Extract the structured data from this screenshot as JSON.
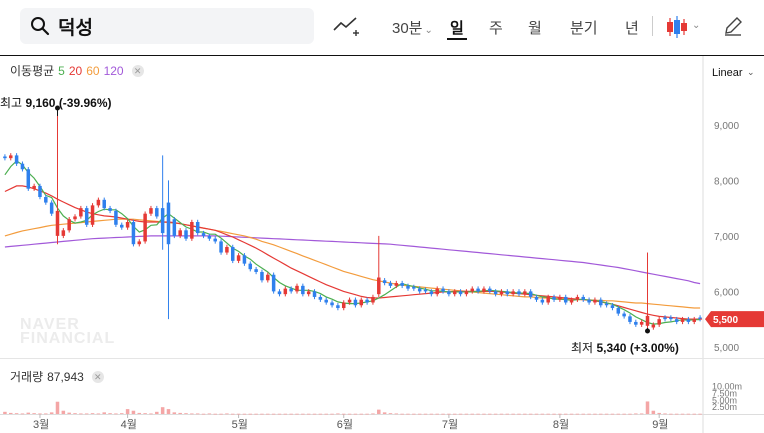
{
  "toolbar": {
    "search_value": "덕성",
    "intervals": [
      "30분",
      "일",
      "주",
      "월",
      "분기",
      "년"
    ],
    "active_interval": "일"
  },
  "ma_legend": {
    "label": "이동평균",
    "periods": [
      {
        "label": "5",
        "color": "#4caf50"
      },
      {
        "label": "20",
        "color": "#e53935"
      },
      {
        "label": "60",
        "color": "#f39c3d"
      },
      {
        "label": "120",
        "color": "#a259d9"
      }
    ]
  },
  "scale_label": "Linear",
  "max_marker": {
    "label": "최고",
    "value": "9,160",
    "change": "(-39.96%)"
  },
  "min_marker": {
    "label": "최저",
    "value": "5,340",
    "change": "(+3.00%)"
  },
  "volume_label": {
    "label": "거래량",
    "value": "87,943"
  },
  "current_price": "5,500",
  "watermark": [
    "NAVER",
    "FINANCIAL"
  ],
  "colors": {
    "up": "#e53935",
    "down": "#2f80ed",
    "ma5": "#4caf50",
    "ma20": "#e53935",
    "ma60": "#f39c3d",
    "ma120": "#a259d9",
    "volume": "#f4a6a6",
    "price_tag": "#e53935"
  },
  "chart_data": {
    "type": "candlestick",
    "y_ticks": [
      "9,000",
      "8,000",
      "7,000",
      "6,000",
      "5,000"
    ],
    "y_ticks_values": [
      9000,
      8000,
      7000,
      6000,
      5000
    ],
    "ylim": [
      4800,
      9700
    ],
    "x_ticks": [
      "3월",
      "4월",
      "5월",
      "6월",
      "7월",
      "8월",
      "9월"
    ],
    "volume_ticks": [
      "10.00m",
      "7.50m",
      "5.00m",
      "2.50m"
    ],
    "volume_ticks_values": [
      10,
      7.5,
      5,
      2.5
    ],
    "volume_max": 11,
    "max_price": 9160,
    "min_price": 5340,
    "last_price": 5500,
    "series_close": [
      8400,
      8450,
      8300,
      8200,
      7850,
      7900,
      7700,
      7600,
      7400,
      7000,
      7100,
      7300,
      7350,
      7500,
      7200,
      7550,
      7650,
      7500,
      7450,
      7200,
      7150,
      7250,
      6850,
      6900,
      7400,
      7500,
      7350,
      7450,
      7300,
      7000,
      7100,
      6950,
      7250,
      7050,
      7000,
      6950,
      6900,
      6700,
      6800,
      6550,
      6650,
      6500,
      6400,
      6350,
      6200,
      6300,
      6000,
      5950,
      6050,
      6000,
      6100,
      5950,
      6000,
      5900,
      5850,
      5800,
      5750,
      5700,
      5800,
      5850,
      5750,
      5850,
      5800,
      5900,
      6200,
      6150,
      6100,
      6150,
      6100,
      6050,
      6050,
      6000,
      6000,
      5950,
      6050,
      6000,
      5950,
      6000,
      5950,
      6000,
      6050,
      6000,
      6050,
      6000,
      5950,
      6000,
      5950,
      6000,
      5950,
      6000,
      5900,
      5850,
      5800,
      5900,
      5850,
      5900,
      5800,
      5850,
      5900,
      5850,
      5800,
      5850,
      5750,
      5750,
      5700,
      5600,
      5550,
      5450,
      5400,
      5450,
      5350,
      5400,
      5500,
      5500,
      5500,
      5450,
      5500,
      5450,
      5500,
      5500
    ],
    "series_ma5": [
      8100,
      8250,
      8350,
      8280,
      8140,
      8040,
      7890,
      7730,
      7690,
      7500,
      7360,
      7280,
      7230,
      7250,
      7280,
      7380,
      7440,
      7480,
      7470,
      7470,
      7400,
      7310,
      7170,
      7070,
      7110,
      7190,
      7200,
      7320,
      7400,
      7320,
      7240,
      7160,
      7120,
      7070,
      7070,
      7030,
      7030,
      6960,
      6870,
      6780,
      6720,
      6640,
      6580,
      6490,
      6420,
      6350,
      6250,
      6160,
      6100,
      6060,
      6020,
      6020,
      6020,
      6000,
      5960,
      5900,
      5860,
      5810,
      5790,
      5780,
      5780,
      5790,
      5810,
      5830,
      5880,
      5940,
      6010,
      6080,
      6140,
      6110,
      6090,
      6060,
      6040,
      6010,
      6010,
      6000,
      5990,
      5990,
      5990,
      5990,
      5990,
      6000,
      6010,
      6020,
      6010,
      6000,
      5990,
      5980,
      5970,
      5970,
      5960,
      5930,
      5900,
      5890,
      5860,
      5860,
      5850,
      5840,
      5850,
      5860,
      5840,
      5840,
      5820,
      5790,
      5770,
      5720,
      5670,
      5610,
      5540,
      5490,
      5440,
      5410,
      5420,
      5440,
      5450,
      5470,
      5490,
      5480,
      5490,
      5490
    ],
    "series_ma20": [
      7800,
      7850,
      7900,
      7900,
      7880,
      7850,
      7810,
      7770,
      7720,
      7660,
      7610,
      7560,
      7510,
      7470,
      7430,
      7400,
      7380,
      7360,
      7350,
      7340,
      7320,
      7300,
      7280,
      7260,
      7250,
      7250,
      7250,
      7250,
      7250,
      7240,
      7220,
      7200,
      7180,
      7160,
      7140,
      7120,
      7100,
      7060,
      7020,
      6980,
      6930,
      6880,
      6830,
      6780,
      6720,
      6660,
      6600,
      6540,
      6480,
      6420,
      6370,
      6320,
      6270,
      6220,
      6170,
      6120,
      6080,
      6040,
      6000,
      5970,
      5940,
      5910,
      5890,
      5880,
      5880,
      5890,
      5900,
      5910,
      5920,
      5930,
      5940,
      5950,
      5960,
      5970,
      5980,
      5990,
      5990,
      6000,
      6000,
      6000,
      6000,
      6000,
      6000,
      6000,
      6000,
      5990,
      5980,
      5970,
      5960,
      5950,
      5940,
      5930,
      5920,
      5910,
      5900,
      5890,
      5880,
      5870,
      5860,
      5850,
      5840,
      5830,
      5810,
      5790,
      5770,
      5740,
      5710,
      5680,
      5650,
      5620,
      5590,
      5570,
      5550,
      5540,
      5530,
      5520,
      5510,
      5500,
      5500,
      5500
    ],
    "series_ma60": [
      7000,
      7030,
      7060,
      7090,
      7110,
      7130,
      7150,
      7170,
      7190,
      7200,
      7210,
      7220,
      7230,
      7240,
      7250,
      7260,
      7270,
      7280,
      7290,
      7300,
      7300,
      7300,
      7300,
      7290,
      7280,
      7270,
      7260,
      7250,
      7240,
      7230,
      7220,
      7200,
      7180,
      7160,
      7140,
      7120,
      7100,
      7080,
      7060,
      7040,
      7020,
      7000,
      6970,
      6940,
      6900,
      6870,
      6840,
      6800,
      6760,
      6720,
      6680,
      6640,
      6600,
      6560,
      6520,
      6480,
      6440,
      6400,
      6360,
      6330,
      6300,
      6270,
      6240,
      6210,
      6190,
      6170,
      6150,
      6130,
      6110,
      6100,
      6090,
      6080,
      6070,
      6060,
      6050,
      6040,
      6030,
      6020,
      6010,
      6000,
      5990,
      5980,
      5970,
      5960,
      5950,
      5940,
      5930,
      5920,
      5910,
      5900,
      5900,
      5890,
      5880,
      5880,
      5870,
      5870,
      5860,
      5860,
      5850,
      5850,
      5850,
      5840,
      5840,
      5830,
      5830,
      5820,
      5810,
      5800,
      5790,
      5790,
      5780,
      5770,
      5760,
      5750,
      5740,
      5730,
      5720,
      5710,
      5700,
      5700
    ],
    "series_ma120": [
      6800,
      6810,
      6820,
      6830,
      6840,
      6850,
      6860,
      6870,
      6880,
      6890,
      6900,
      6910,
      6920,
      6930,
      6940,
      6950,
      6955,
      6960,
      6965,
      6970,
      6975,
      6980,
      6985,
      6990,
      6995,
      7000,
      7000,
      7000,
      7000,
      7000,
      7000,
      7000,
      7000,
      7000,
      7000,
      7000,
      7000,
      6995,
      6990,
      6985,
      6980,
      6975,
      6970,
      6965,
      6960,
      6955,
      6950,
      6945,
      6940,
      6935,
      6930,
      6925,
      6920,
      6915,
      6910,
      6905,
      6900,
      6895,
      6890,
      6885,
      6880,
      6875,
      6870,
      6865,
      6860,
      6855,
      6850,
      6840,
      6830,
      6820,
      6810,
      6800,
      6790,
      6780,
      6770,
      6760,
      6750,
      6740,
      6730,
      6720,
      6710,
      6700,
      6690,
      6680,
      6670,
      6660,
      6650,
      6640,
      6630,
      6620,
      6610,
      6600,
      6590,
      6580,
      6570,
      6560,
      6550,
      6540,
      6530,
      6520,
      6505,
      6490,
      6475,
      6460,
      6445,
      6430,
      6410,
      6390,
      6370,
      6350,
      6330,
      6310,
      6290,
      6270,
      6250,
      6230,
      6210,
      6190,
      6160,
      6140
    ],
    "spikes": [
      {
        "index": 9,
        "high": 9160,
        "low": 6850,
        "open": 7000,
        "close": 7450
      },
      {
        "index": 27,
        "high": 8450,
        "low": 6750,
        "open": 7500,
        "close": 7050
      },
      {
        "index": 28,
        "high": 8000,
        "low": 5500,
        "open": 7600,
        "close": 6850
      },
      {
        "index": 64,
        "high": 7000,
        "low": 5900,
        "open": 5950,
        "close": 6250
      },
      {
        "index": 110,
        "high": 6700,
        "low": 5340,
        "open": 5380,
        "close": 5560
      }
    ],
    "volume_millions": [
      0.8,
      0.4,
      0.3,
      0.2,
      0.5,
      0.3,
      0.2,
      0.2,
      0.6,
      4.5,
      1.2,
      0.5,
      0.3,
      0.2,
      0.2,
      0.3,
      0.2,
      0.6,
      0.3,
      0.2,
      0.3,
      1.8,
      1.2,
      0.4,
      0.3,
      0.2,
      0.8,
      2.5,
      1.8,
      0.6,
      0.4,
      0.3,
      0.2,
      0.2,
      0.1,
      0.2,
      0.1,
      0.1,
      0.2,
      0.1,
      0.1,
      0.1,
      0.1,
      0.1,
      0.1,
      0.1,
      0.1,
      0.1,
      0.1,
      0.1,
      0.1,
      0.1,
      0.1,
      0.1,
      0.1,
      0.1,
      0.1,
      0.2,
      0.1,
      0.1,
      0.1,
      0.1,
      0.1,
      0.2,
      1.6,
      0.6,
      0.3,
      0.2,
      0.1,
      0.1,
      0.1,
      0.1,
      0.1,
      0.1,
      0.1,
      0.1,
      0.1,
      0.1,
      0.1,
      0.1,
      0.1,
      0.1,
      0.1,
      0.1,
      0.1,
      0.1,
      0.1,
      0.1,
      0.1,
      0.1,
      0.1,
      0.1,
      0.1,
      0.1,
      0.1,
      0.1,
      0.1,
      0.1,
      0.1,
      0.1,
      0.1,
      0.1,
      0.1,
      0.1,
      0.1,
      0.1,
      0.1,
      0.1,
      0.2,
      0.2,
      4.6,
      1.2,
      0.4,
      0.2,
      0.1,
      0.1,
      0.1,
      0.1,
      0.1,
      0.1
    ]
  }
}
